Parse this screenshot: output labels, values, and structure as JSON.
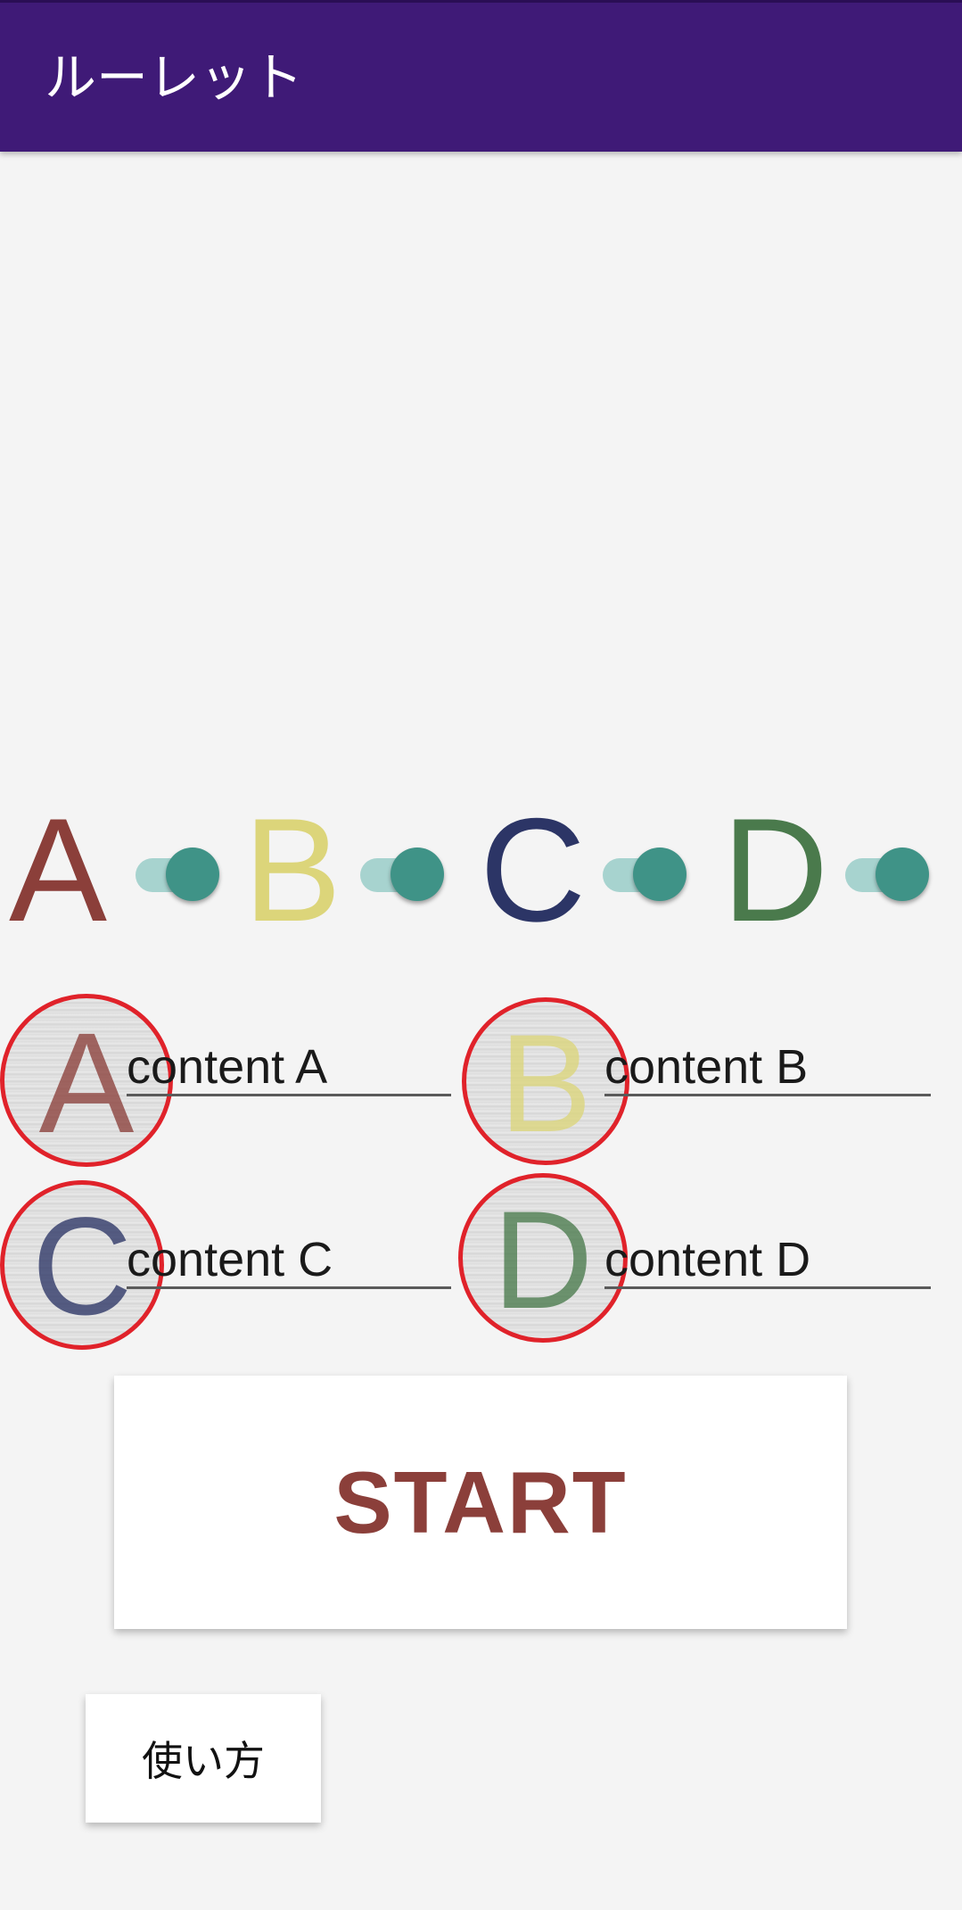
{
  "appbar": {
    "title": "ルーレット"
  },
  "colors": {
    "appbar": "#3f1a77",
    "a": "#8b3f3a",
    "b": "#dcd57a",
    "c": "#2c3566",
    "d": "#4a7a4c",
    "switch_on": "#3f9387",
    "circle_border": "#e0222a"
  },
  "toggles": [
    {
      "letter": "A",
      "checked": true
    },
    {
      "letter": "B",
      "checked": true
    },
    {
      "letter": "C",
      "checked": true
    },
    {
      "letter": "D",
      "checked": true
    }
  ],
  "fields": [
    {
      "badge": "A",
      "value": "content A"
    },
    {
      "badge": "B",
      "value": "content B"
    },
    {
      "badge": "C",
      "value": "content C"
    },
    {
      "badge": "D",
      "value": "content D"
    }
  ],
  "buttons": {
    "start": "START",
    "howto": "使い方"
  }
}
